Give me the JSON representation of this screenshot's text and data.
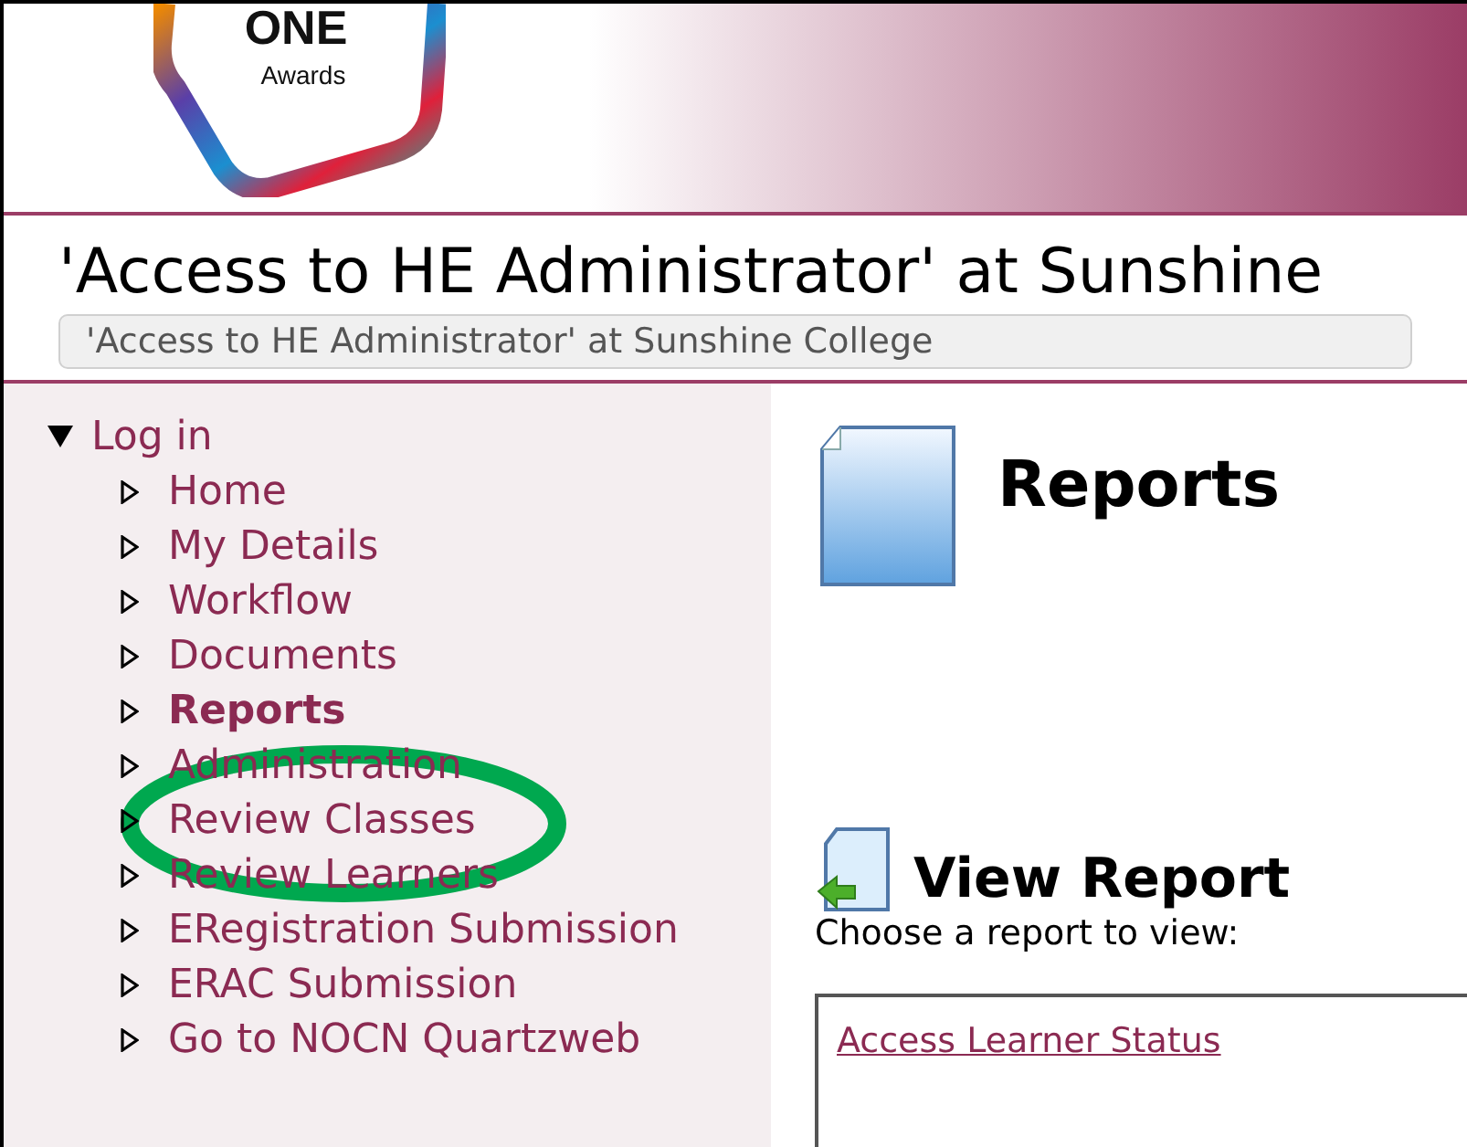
{
  "logo": {
    "name": "ONE",
    "caption": "Awards"
  },
  "header": {
    "title": "'Access to HE Administrator' at Sunshine",
    "subtitle": "'Access to HE Administrator' at Sunshine College"
  },
  "nav": {
    "label": "Log in",
    "expanded": true,
    "children": [
      {
        "label": "Home",
        "selected": false,
        "expanded": false
      },
      {
        "label": "My Details",
        "selected": false,
        "expanded": false
      },
      {
        "label": "Workflow",
        "selected": false,
        "expanded": false
      },
      {
        "label": "Documents",
        "selected": false,
        "expanded": false
      },
      {
        "label": "Reports",
        "selected": true,
        "expanded": false
      },
      {
        "label": "Administration",
        "selected": false,
        "expanded": false
      },
      {
        "label": "Review Classes",
        "selected": false,
        "expanded": false
      },
      {
        "label": "Review Learners",
        "selected": false,
        "expanded": false
      },
      {
        "label": "ERegistration Submission",
        "selected": false,
        "expanded": false
      },
      {
        "label": "ERAC Submission",
        "selected": false,
        "expanded": false
      },
      {
        "label": "Go to NOCN Quartzweb",
        "selected": false,
        "expanded": false
      }
    ]
  },
  "annotation": {
    "kind": "ellipse",
    "color": "#00a84f"
  },
  "content": {
    "title": "Reports",
    "section": {
      "title": "View Report",
      "prompt": "Choose a report to view:",
      "reports": [
        "Access Learner Status"
      ]
    }
  }
}
